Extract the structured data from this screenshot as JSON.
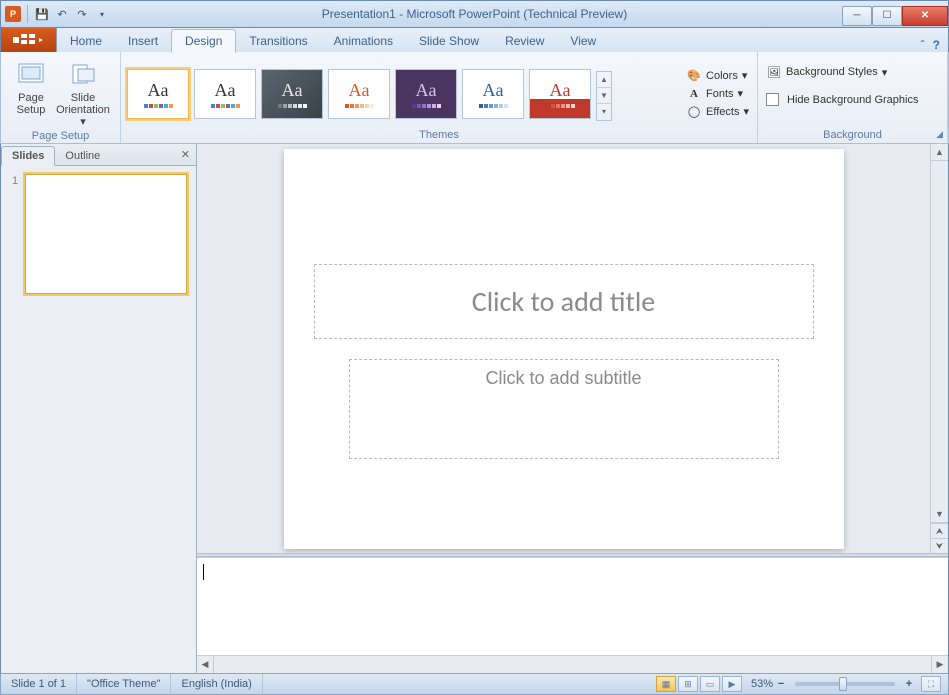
{
  "window": {
    "title": "Presentation1 - Microsoft PowerPoint (Technical Preview)"
  },
  "tabs": {
    "items": [
      "Home",
      "Insert",
      "Design",
      "Transitions",
      "Animations",
      "Slide Show",
      "Review",
      "View"
    ],
    "active": "Design"
  },
  "ribbon": {
    "pageSetup": {
      "label": "Page Setup",
      "page_setup": "Page Setup",
      "orientation": "Slide Orientation"
    },
    "themes": {
      "label": "Themes",
      "colors": "Colors",
      "fonts": "Fonts",
      "effects": "Effects"
    },
    "background": {
      "label": "Background",
      "styles": "Background Styles",
      "hide": "Hide Background Graphics"
    }
  },
  "sidepanel": {
    "slides": "Slides",
    "outline": "Outline",
    "slide_number": "1"
  },
  "slide": {
    "title_placeholder": "Click to add title",
    "subtitle_placeholder": "Click to add subtitle"
  },
  "status": {
    "slide_info": "Slide 1 of 1",
    "theme": "\"Office Theme\"",
    "language": "English (India)",
    "zoom": "53%"
  },
  "theme_swatches": [
    [
      "#4f81bd",
      "#c0504d",
      "#9bbb59",
      "#8064a2",
      "#4bacc6",
      "#f79646"
    ],
    [
      "#4f81bd",
      "#c0504d",
      "#9bbb59",
      "#8064a2",
      "#4bacc6",
      "#f79646"
    ],
    [
      "#6c7a89",
      "#9aa5ad",
      "#bac3c8",
      "#d5dbe0",
      "#e8ebee",
      "#f4f6f7"
    ],
    [
      "#d95b1f",
      "#e07b3f",
      "#e89a65",
      "#efb78d",
      "#f5d3b6",
      "#fae9dc"
    ],
    [
      "#663399",
      "#8052b3",
      "#9a71c6",
      "#b491d8",
      "#ceb1ea",
      "#e8d3f7"
    ],
    [
      "#2e5e9e",
      "#4d79b3",
      "#6d94c7",
      "#8dafda",
      "#aecaec",
      "#cfe4fa"
    ],
    [
      "#c0392b",
      "#d0584c",
      "#df776d",
      "#e9968e",
      "#f2b5af",
      "#fad4d0"
    ]
  ]
}
